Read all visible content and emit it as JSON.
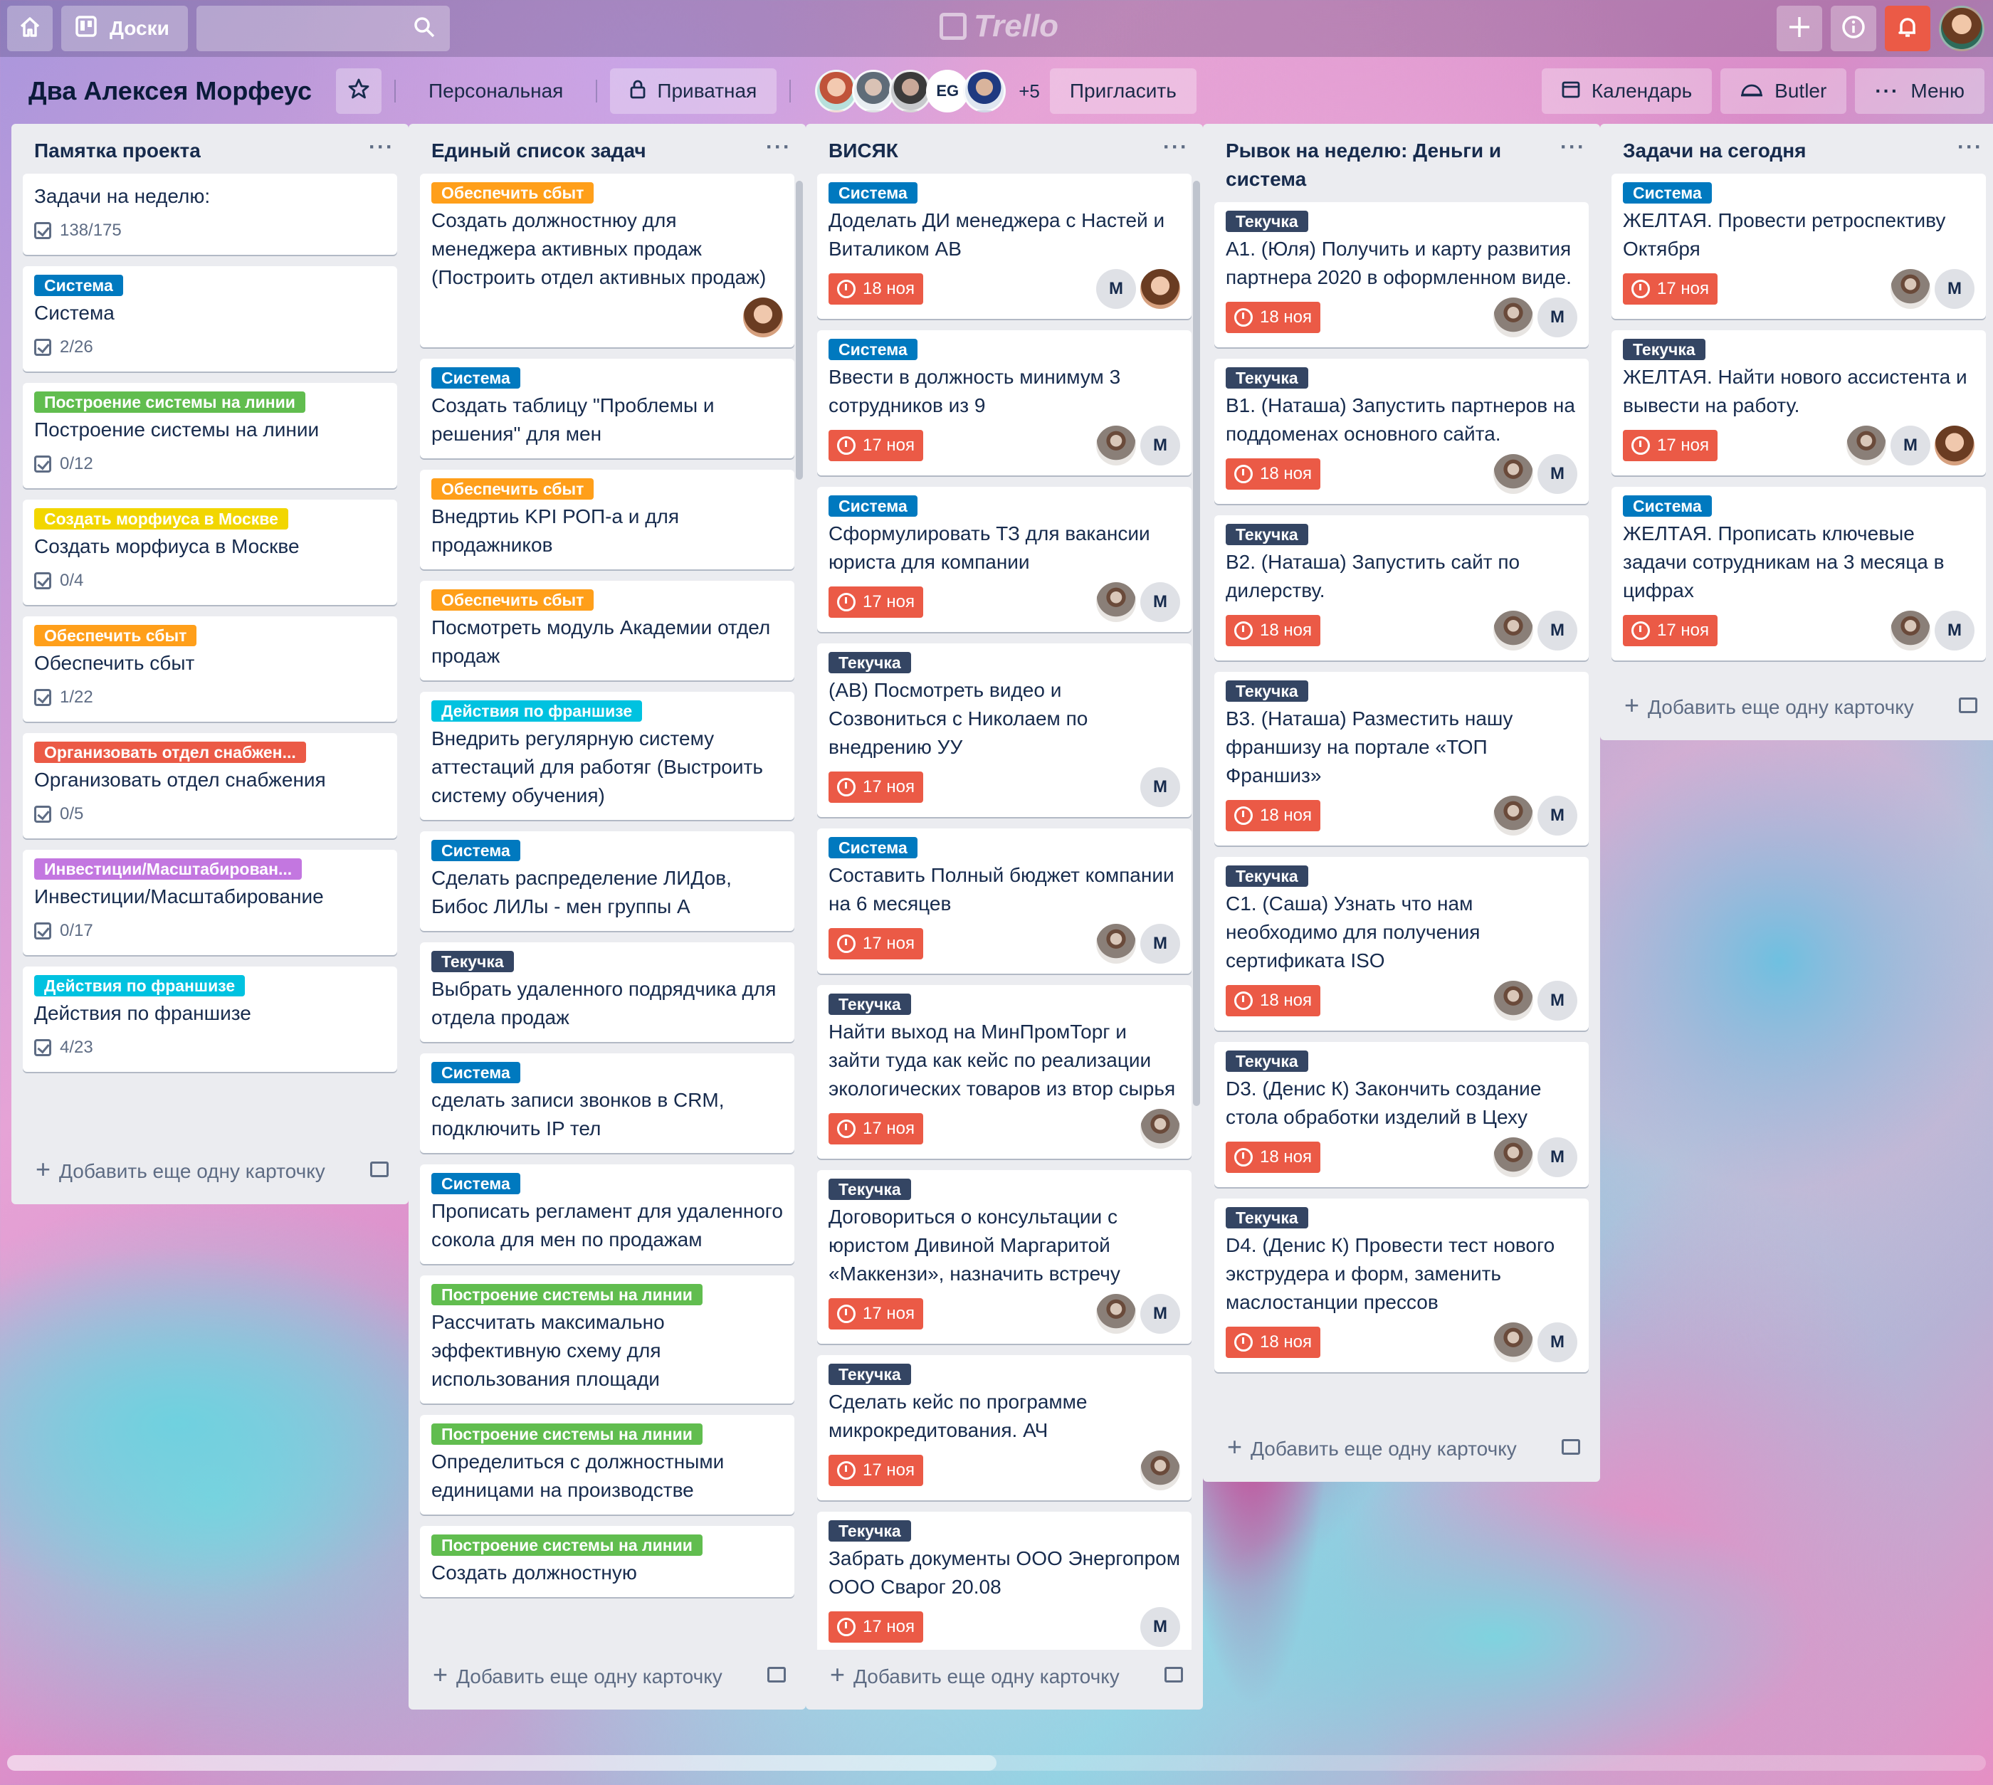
{
  "colors": {
    "orange": "#ff9f1a",
    "blue": "#0079bf",
    "green": "#61bd4f",
    "yellow": "#f2d600",
    "red": "#eb5a46",
    "purple": "#c377e0",
    "sky": "#00c2e0",
    "black": "#344563"
  },
  "topbar": {
    "boards_label": "Доски",
    "logo": "Trello",
    "icons": [
      "home-icon",
      "boards-icon",
      "search-icon",
      "plus-icon",
      "info-icon",
      "bell-icon"
    ]
  },
  "board": {
    "title": "Два Алексея Морфеус",
    "visibility_team": "Персональная",
    "visibility": "Приватная",
    "member_initials": "EG",
    "more_members": "+5",
    "invite": "Пригласить",
    "calendar": "Календарь",
    "butler": "Butler",
    "menu": "Меню"
  },
  "add_card": "Добавить еще одну карточку",
  "lists": [
    {
      "title": "Памятка проекта",
      "cards": [
        {
          "text": "Задачи на неделю:",
          "checklist": "138/175"
        },
        {
          "label": "Система",
          "color": "blue",
          "text": "Система",
          "checklist": "2/26"
        },
        {
          "label": "Построение системы на линии",
          "color": "green",
          "text": "Построение системы на линии",
          "checklist": "0/12"
        },
        {
          "label": "Создать морфиуса в Москве",
          "color": "yellow",
          "text": "Создать морфиуса в Москве",
          "checklist": "0/4"
        },
        {
          "label": "Обеспечить сбыт",
          "color": "orange",
          "text": "Обеспечить сбыт",
          "checklist": "1/22"
        },
        {
          "label": "Организовать отдел снабжен...",
          "color": "red",
          "text": "Организовать отдел снабжения",
          "checklist": "0/5"
        },
        {
          "label": "Инвестиции/Масштабирован...",
          "color": "purple",
          "text": "Инвестиции/Масштабирование",
          "checklist": "0/17"
        },
        {
          "label": "Действия по франшизе",
          "color": "sky",
          "text": "Действия по франшизе",
          "checklist": "4/23"
        }
      ]
    },
    {
      "title": "Единый список задач",
      "cards": [
        {
          "label": "Обеспечить сбыт",
          "color": "orange",
          "text": "Создать должностнюу для менеджера активных продаж (Построить отдел активных продаж)",
          "members": [
            "ph2"
          ]
        },
        {
          "label": "Система",
          "color": "blue",
          "text": "Создать таблицу \"Проблемы и решения\" для мен"
        },
        {
          "label": "Обеспечить сбыт",
          "color": "orange",
          "text": "Внедртиь KPI РОП-а и для продажников"
        },
        {
          "label": "Обеспечить сбыт",
          "color": "orange",
          "text": "Посмотреть модуль Академии отдел продаж"
        },
        {
          "label": "Действия по франшизе",
          "color": "sky",
          "text": "Внедрить регулярную систему аттестаций для работяг (Выстроить систему обучения)"
        },
        {
          "label": "Система",
          "color": "blue",
          "text": "Сделать распределение ЛИДов, Бибос ЛИЛы - мен группы А"
        },
        {
          "label": "Текучка",
          "color": "black",
          "text": "Выбрать удаленного подрядчика для отдела продаж"
        },
        {
          "label": "Система",
          "color": "blue",
          "text": "сделать записи звонков в CRM, подключить IP тел"
        },
        {
          "label": "Система",
          "color": "blue",
          "text": "Прописать регламент для удаленного сокола для мен по продажам"
        },
        {
          "label": "Построение системы на линии",
          "color": "green",
          "text": "Рассчитать максимально эффективную схему для использования площади"
        },
        {
          "label": "Построение системы на линии",
          "color": "green",
          "text": "Определиться с должностными единицами на производстве"
        },
        {
          "label": "Построение системы на линии",
          "color": "green",
          "text": "Создать должностную"
        }
      ]
    },
    {
      "title": "ВИСЯК",
      "cards": [
        {
          "label": "Система",
          "color": "blue",
          "text": "Доделать ДИ менеджера с Настей и Виталиком АВ",
          "due": "18 ноя",
          "members": [
            "m",
            "ph2"
          ]
        },
        {
          "label": "Система",
          "color": "blue",
          "text": "Ввести в должность минимум 3 сотрудников из 9",
          "due": "17 ноя",
          "members": [
            "ph",
            "m"
          ]
        },
        {
          "label": "Система",
          "color": "blue",
          "text": "Сформулировать ТЗ для вакансии юриста для компании",
          "due": "17 ноя",
          "members": [
            "ph",
            "m"
          ]
        },
        {
          "label": "Текучка",
          "color": "black",
          "text": "(АВ) Посмотреть видео и Созвониться с Николаем по внедрению УУ",
          "due": "17 ноя",
          "members": [
            "m"
          ]
        },
        {
          "label": "Система",
          "color": "blue",
          "text": "Составить Полный бюджет компании на 6 месяцев",
          "due": "17 ноя",
          "members": [
            "ph",
            "m"
          ]
        },
        {
          "label": "Текучка",
          "color": "black",
          "text": "Найти выход на МинПромТорг и зайти туда как кейс по реализации экологических товаров из втор сырья",
          "due": "17 ноя",
          "members": [
            "ph"
          ]
        },
        {
          "label": "Текучка",
          "color": "black",
          "text": "Договориться о консультации с юристом Дивиной Маргаритой «Маккензи», назначить встречу",
          "due": "17 ноя",
          "members": [
            "ph",
            "m"
          ]
        },
        {
          "label": "Текучка",
          "color": "black",
          "text": "Сделать кейс по программе микрокредитования. АЧ",
          "due": "17 ноя",
          "members": [
            "ph"
          ]
        },
        {
          "label": "Текучка",
          "color": "black",
          "text": "Забрать документы ООО Энергопром ООО Сварог 20.08",
          "due": "17 ноя",
          "members": [
            "m"
          ]
        }
      ]
    },
    {
      "title": "Рывок на неделю: Деньги и система",
      "cards": [
        {
          "label": "Текучка",
          "color": "black",
          "text": "А1. (Юля) Получить и карту развития партнера 2020 в оформленном виде.",
          "due": "18 ноя",
          "members": [
            "ph",
            "m"
          ]
        },
        {
          "label": "Текучка",
          "color": "black",
          "text": "В1. (Наташа) Запустить партнеров на поддоменах основного сайта.",
          "due": "18 ноя",
          "members": [
            "ph",
            "m"
          ]
        },
        {
          "label": "Текучка",
          "color": "black",
          "text": "В2. (Наташа) Запустить сайт по дилерству.",
          "due": "18 ноя",
          "members": [
            "ph",
            "m"
          ]
        },
        {
          "label": "Текучка",
          "color": "black",
          "text": "В3. (Наташа) Разместить нашу франшизу на портале «ТОП Франшиз»",
          "due": "18 ноя",
          "members": [
            "ph",
            "m"
          ]
        },
        {
          "label": "Текучка",
          "color": "black",
          "text": "С1. (Саша) Узнать что нам необходимо для получения сертификата ISO",
          "due": "18 ноя",
          "members": [
            "ph",
            "m"
          ]
        },
        {
          "label": "Текучка",
          "color": "black",
          "text": "D3. (Денис К) Закончить создание стола обработки изделий в Цеху",
          "due": "18 ноя",
          "members": [
            "ph",
            "m"
          ]
        },
        {
          "label": "Текучка",
          "color": "black",
          "text": "D4. (Денис К) Провести тест нового экструдера и форм, заменить маслостанции прессов",
          "due": "18 ноя",
          "members": [
            "ph",
            "m"
          ]
        }
      ]
    },
    {
      "title": "Задачи на сегодня",
      "cards": [
        {
          "label": "Система",
          "color": "blue",
          "text": "ЖЕЛТАЯ. Провести ретроспективу Октября",
          "due": "17 ноя",
          "members": [
            "ph",
            "m"
          ]
        },
        {
          "label": "Текучка",
          "color": "black",
          "text": "ЖЕЛТАЯ. Найти нового ассистента и вывести на работу.",
          "due": "17 ноя",
          "members": [
            "ph",
            "m",
            "ph2"
          ]
        },
        {
          "label": "Система",
          "color": "blue",
          "text": "ЖЕЛТАЯ. Прописать ключевые задачи сотрудникам на 3 месяца в цифрах",
          "due": "17 ноя",
          "members": [
            "ph",
            "m"
          ]
        }
      ]
    }
  ]
}
